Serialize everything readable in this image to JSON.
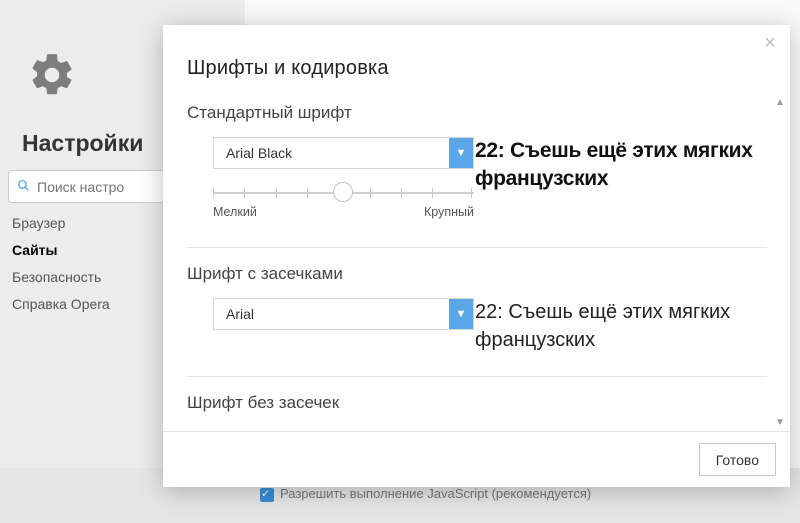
{
  "sidebar": {
    "title": "Настройки",
    "search_placeholder": "Поиск настро",
    "items": [
      {
        "label": "Браузер"
      },
      {
        "label": "Сайты"
      },
      {
        "label": "Безопасность"
      },
      {
        "label": "Справка Opera"
      }
    ]
  },
  "background_footer": "Разрешить выполнение JavaScript (рекомендуется)",
  "dialog": {
    "title": "Шрифты и кодировка",
    "close_glyph": "×",
    "sections": {
      "standard": {
        "label": "Стандартный шрифт",
        "select_value": "Arial Black",
        "slider_min_label": "Мелкий",
        "slider_max_label": "Крупный",
        "preview": "22: Съешь ещё этих мягких французских"
      },
      "serif": {
        "label": "Шрифт с засечками",
        "select_value": "Arial",
        "preview": "22: Съешь ещё этих мягких французских"
      },
      "sans": {
        "label": "Шрифт без засечек"
      }
    },
    "done_label": "Готово"
  }
}
